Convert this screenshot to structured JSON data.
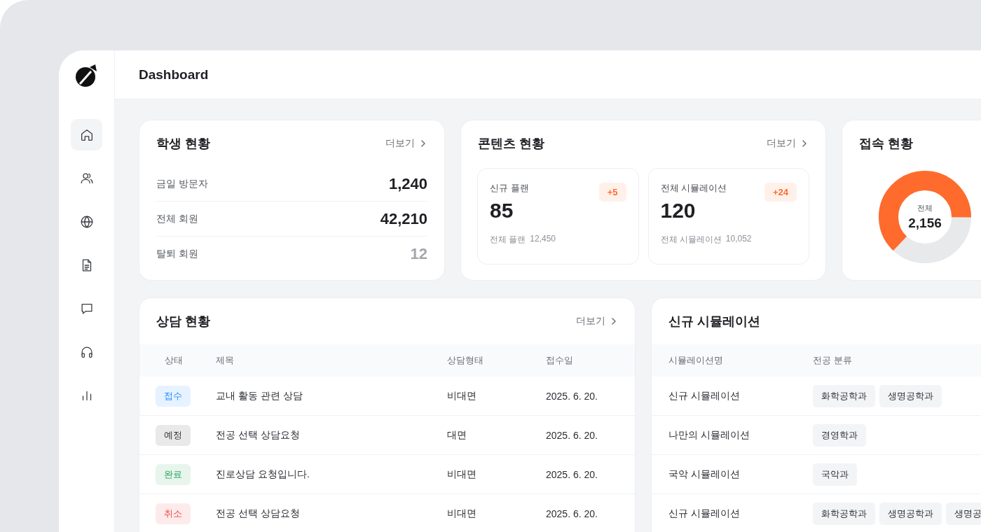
{
  "sidebar": {
    "items": [
      {
        "selected": true
      },
      {
        "selected": false
      },
      {
        "selected": false
      },
      {
        "selected": false
      },
      {
        "selected": false
      },
      {
        "selected": false
      },
      {
        "selected": false
      }
    ]
  },
  "header": {
    "title": "Dashboard"
  },
  "student_card": {
    "title": "학생 현황",
    "more": "더보기",
    "rows": [
      {
        "label": "금일 방문자",
        "value": "1,240",
        "muted": false
      },
      {
        "label": "전체 회원",
        "value": "42,210",
        "muted": false
      },
      {
        "label": "탈퇴 회원",
        "value": "12",
        "muted": true
      }
    ]
  },
  "content_card": {
    "title": "콘텐츠 현황",
    "more": "더보기",
    "tiles": [
      {
        "label": "신규 플랜",
        "badge": "+5",
        "value": "85",
        "footer_label": "전체 플랜",
        "footer_value": "12,450"
      },
      {
        "label": "전체 시뮬레이션",
        "badge": "+24",
        "value": "120",
        "footer_label": "전체 시뮬레이션",
        "footer_value": "10,052"
      }
    ]
  },
  "access_card": {
    "title": "접속 현황",
    "donut": {
      "level": 0.63,
      "label": "전체",
      "value": "2,156"
    }
  },
  "consult_card": {
    "title": "상담 현황",
    "more": "더보기",
    "columns": [
      "상태",
      "제목",
      "상담형태",
      "접수일"
    ],
    "rows": [
      {
        "status": "접수",
        "color": "#1a8cff",
        "title": "교내 활동 관련 상담",
        "type": "비대면",
        "date": "2025. 6. 20."
      },
      {
        "status": "예정",
        "color": "#333333",
        "title": "전공 선택 상담요청",
        "type": "대면",
        "date": "2025. 6. 20."
      },
      {
        "status": "완료",
        "color": "#22a35a",
        "title": "진로상담 요청입니다.",
        "type": "비대면",
        "date": "2025. 6. 20."
      },
      {
        "status": "취소",
        "color": "#f04848",
        "title": "전공 선택 상담요청",
        "type": "비대면",
        "date": "2025. 6. 20."
      }
    ]
  },
  "simulation_card": {
    "title": "신규 시뮬레이션",
    "columns": [
      "시뮬레이션명",
      "전공 분류"
    ],
    "rows": [
      {
        "name": "신규 시뮬레이션",
        "tags": [
          "화학공학과",
          "생명공학과"
        ]
      },
      {
        "name": "나만의 시뮬레이션",
        "tags": [
          "경영학과"
        ]
      },
      {
        "name": "국악 시뮬레이션",
        "tags": [
          "국악과"
        ]
      },
      {
        "name": "신규 시뮬레이션",
        "tags": [
          "화학공학과",
          "생명공학과",
          "생명공"
        ]
      }
    ]
  }
}
